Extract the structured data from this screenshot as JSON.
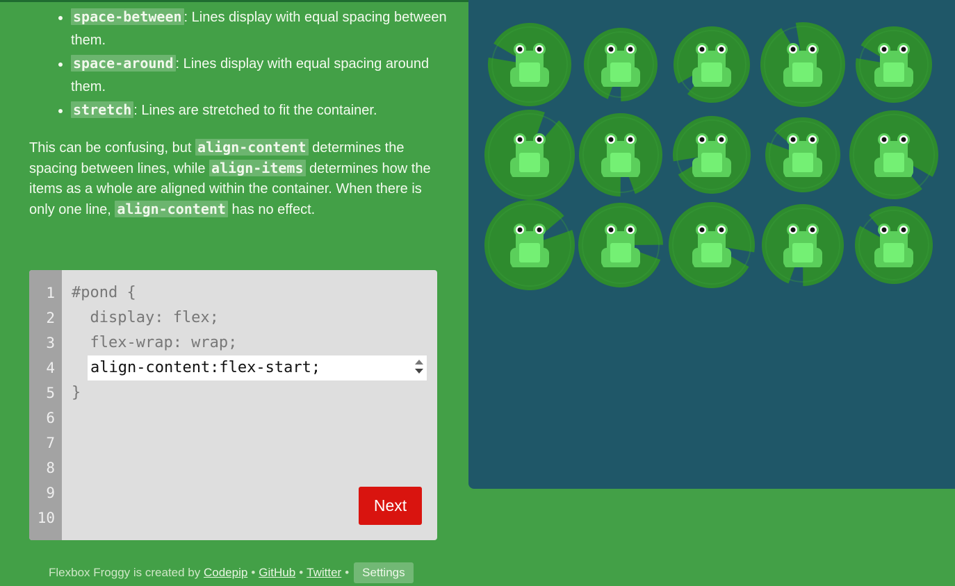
{
  "instructions": {
    "bullets": [
      {
        "code": "space-between",
        "text": ": Lines display with equal spacing between them."
      },
      {
        "code": "space-around",
        "text": ": Lines display with equal spacing around them."
      },
      {
        "code": "stretch",
        "text": ": Lines are stretched to fit the container."
      }
    ],
    "paragraph": {
      "p1": "This can be confusing, but ",
      "c1": "align-content",
      "p2": " determines the spacing between lines, while ",
      "c2": "align-items",
      "p3": " determines how the items as a whole are aligned within the container. When there is only one line, ",
      "c3": "align-content",
      "p4": " has no effect."
    }
  },
  "editor": {
    "line_numbers": [
      "1",
      "2",
      "3",
      "4",
      "5",
      "6",
      "7",
      "8",
      "9",
      "10"
    ],
    "lines": [
      "#pond {",
      "  display: flex;",
      "  flex-wrap: wrap;",
      "}"
    ],
    "answer_value": "align-content:flex-start;",
    "next_label": "Next"
  },
  "footer": {
    "prefix": "Flexbox Froggy is created by",
    "link1": "Codepip",
    "link2": "GitHub",
    "link3": "Twitter",
    "settings": "Settings",
    "separator": "•"
  },
  "pond": {
    "rows": 3,
    "columns": 5,
    "frog_count": 15
  },
  "colors": {
    "background": "#43a047",
    "pond": "#1f5768",
    "lilypad": "#2e8b2e",
    "frog_body": "#5bcf5b",
    "frog_belly": "#74f074",
    "next_button": "#d9140f"
  }
}
